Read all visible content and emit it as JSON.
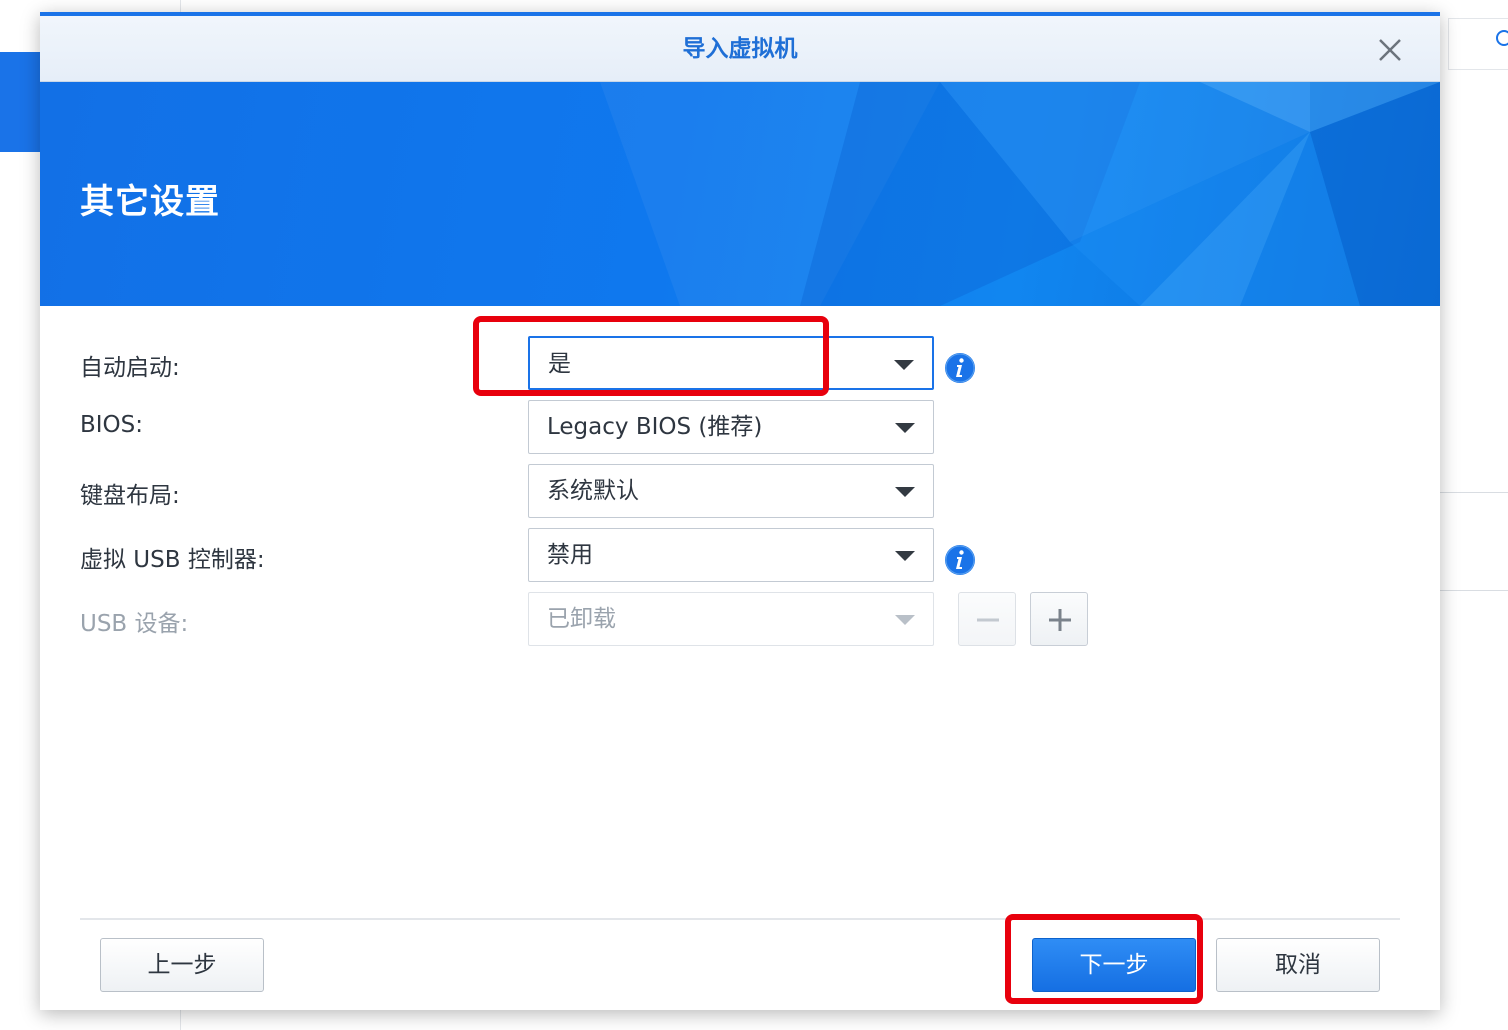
{
  "dialog": {
    "title": "导入虚拟机",
    "close_icon": "close-icon"
  },
  "banner": {
    "title": "其它设置"
  },
  "form": {
    "autostart": {
      "label": "自动启动:",
      "value": "是"
    },
    "bios": {
      "label": "BIOS:",
      "value": "Legacy BIOS (推荐)"
    },
    "keyboard": {
      "label": "键盘布局:",
      "value": "系统默认"
    },
    "usb_controller": {
      "label": "虚拟 USB 控制器:",
      "value": "禁用"
    },
    "usb_device": {
      "label": "USB 设备:",
      "value": "已卸载",
      "disabled": true
    }
  },
  "footer": {
    "back_label": "上一步",
    "next_label": "下一步",
    "cancel_label": "取消"
  },
  "colors": {
    "accent": "#1a73e8",
    "highlight": "#e8000d",
    "title_text": "#1f6fd6"
  }
}
